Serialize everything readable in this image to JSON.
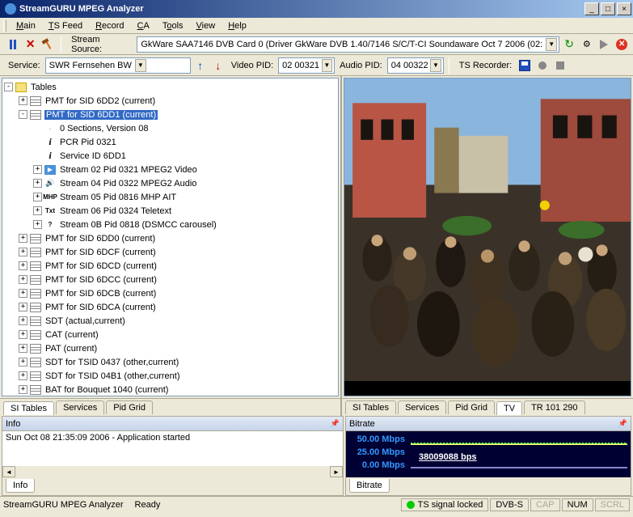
{
  "window": {
    "title": "StreamGURU MPEG Analyzer"
  },
  "menu": {
    "main": "Main",
    "tsfeed": "TS Feed",
    "record": "Record",
    "ca": "CA",
    "tools": "Tools",
    "view": "View",
    "help": "Help"
  },
  "toolbar1": {
    "stream_source_label": "Stream Source:",
    "stream_source_value": "GkWare SAA7146 DVB Card 0 (Driver GkWare DVB 1.40/7146 S/C/T-CI Soundaware Oct  7 2006 (02:"
  },
  "toolbar2": {
    "service_label": "Service:",
    "service_value": "SWR Fernsehen BW",
    "video_pid_label": "Video PID:",
    "video_pid_value": "02 00321",
    "audio_pid_label": "Audio PID:",
    "audio_pid_value": "04 00322",
    "ts_recorder_label": "TS Recorder:"
  },
  "tree": {
    "root": "Tables",
    "nodes": [
      {
        "depth": 1,
        "exp": "+",
        "icon": "table",
        "label": "PMT for SID 6DD2 (current)"
      },
      {
        "depth": 1,
        "exp": "-",
        "icon": "table",
        "label": "PMT for SID 6DD1 (current)",
        "selected": true
      },
      {
        "depth": 2,
        "exp": " ",
        "icon": "dot",
        "label": "0 Sections, Version 08"
      },
      {
        "depth": 2,
        "exp": " ",
        "icon": "info",
        "label": "PCR Pid 0321"
      },
      {
        "depth": 2,
        "exp": " ",
        "icon": "info",
        "label": "Service ID 6DD1"
      },
      {
        "depth": 2,
        "exp": "+",
        "icon": "video",
        "label": "Stream 02 Pid 0321 MPEG2 Video"
      },
      {
        "depth": 2,
        "exp": "+",
        "icon": "audio",
        "label": "Stream 04 Pid 0322 MPEG2 Audio"
      },
      {
        "depth": 2,
        "exp": "+",
        "icon": "text",
        "iconText": "MHP",
        "label": "Stream 05 Pid 0816 MHP AIT"
      },
      {
        "depth": 2,
        "exp": "+",
        "icon": "text",
        "iconText": "Txt",
        "label": "Stream 06 Pid 0324 Teletext"
      },
      {
        "depth": 2,
        "exp": "+",
        "icon": "text",
        "iconText": "?",
        "label": "Stream 0B Pid 0818 (DSMCC carousel)"
      },
      {
        "depth": 1,
        "exp": "+",
        "icon": "table",
        "label": "PMT for SID 6DD0 (current)"
      },
      {
        "depth": 1,
        "exp": "+",
        "icon": "table",
        "label": "PMT for SID 6DCF (current)"
      },
      {
        "depth": 1,
        "exp": "+",
        "icon": "table",
        "label": "PMT for SID 6DCD (current)"
      },
      {
        "depth": 1,
        "exp": "+",
        "icon": "table",
        "label": "PMT for SID 6DCC (current)"
      },
      {
        "depth": 1,
        "exp": "+",
        "icon": "table",
        "label": "PMT for SID 6DCB (current)"
      },
      {
        "depth": 1,
        "exp": "+",
        "icon": "table",
        "label": "PMT for SID 6DCA (current)"
      },
      {
        "depth": 1,
        "exp": "+",
        "icon": "table",
        "label": "SDT (actual,current)"
      },
      {
        "depth": 1,
        "exp": "+",
        "icon": "table",
        "label": "CAT (current)"
      },
      {
        "depth": 1,
        "exp": "+",
        "icon": "table",
        "label": "PAT (current)"
      },
      {
        "depth": 1,
        "exp": "+",
        "icon": "table",
        "label": "SDT for TSID 0437 (other,current)"
      },
      {
        "depth": 1,
        "exp": "+",
        "icon": "table",
        "label": "SDT for TSID 04B1 (other,current)"
      },
      {
        "depth": 1,
        "exp": "+",
        "icon": "table",
        "label": "BAT for Bouquet 1040 (current)"
      }
    ]
  },
  "left_tabs": {
    "t1": "SI Tables",
    "t2": "Services",
    "t3": "Pid Grid"
  },
  "right_tabs": {
    "t1": "SI Tables",
    "t2": "Services",
    "t3": "Pid Grid",
    "t4": "TV",
    "t5": "TR 101 290"
  },
  "info": {
    "title": "Info",
    "line1": "Sun Oct 08 21:35:09 2006 - Application started",
    "tab": "Info"
  },
  "bitrate": {
    "title": "Bitrate",
    "scale_top": "50.00 Mbps",
    "scale_mid": "25.00 Mbps",
    "scale_bot": "0.00 Mbps",
    "current": "38009088 bps",
    "tab": "Bitrate"
  },
  "status": {
    "app": "StreamGURU MPEG Analyzer",
    "ready": "Ready",
    "signal": "TS signal locked",
    "mode": "DVB-S",
    "cap": "CAP",
    "num": "NUM",
    "scrl": "SCRL"
  }
}
